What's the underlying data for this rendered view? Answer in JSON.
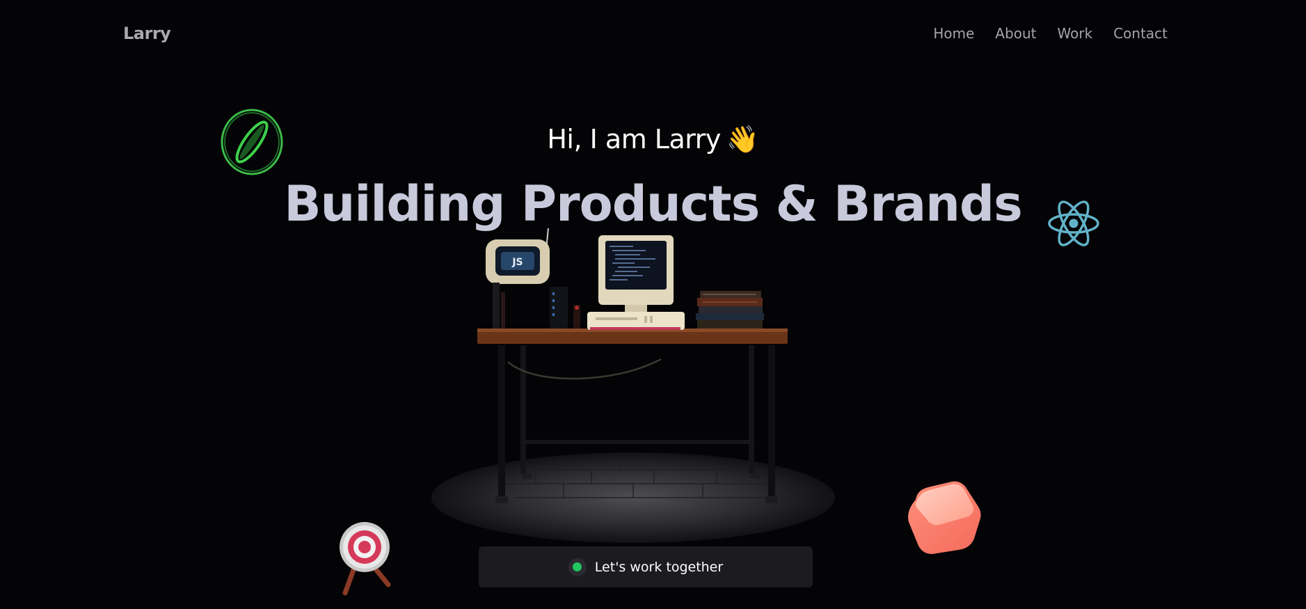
{
  "header": {
    "brand": "Larry",
    "nav": [
      {
        "label": "Home"
      },
      {
        "label": "About"
      },
      {
        "label": "Work"
      },
      {
        "label": "Contact"
      }
    ]
  },
  "hero": {
    "greeting": "Hi, I am Larry",
    "greeting_emoji": "👋",
    "headline": "Building Products & Brands",
    "screen_logo": "JS"
  },
  "cta": {
    "label": "Let's work together",
    "status_color": "#22c55e"
  },
  "floating_icons": [
    {
      "name": "green-ring-icon"
    },
    {
      "name": "react-atom-icon"
    },
    {
      "name": "target-icon"
    },
    {
      "name": "pink-cube-icon"
    }
  ],
  "colors": {
    "background": "#040406",
    "headline": "#c8c9db",
    "react": "#61b3c9",
    "accent_green": "#22c55e"
  }
}
